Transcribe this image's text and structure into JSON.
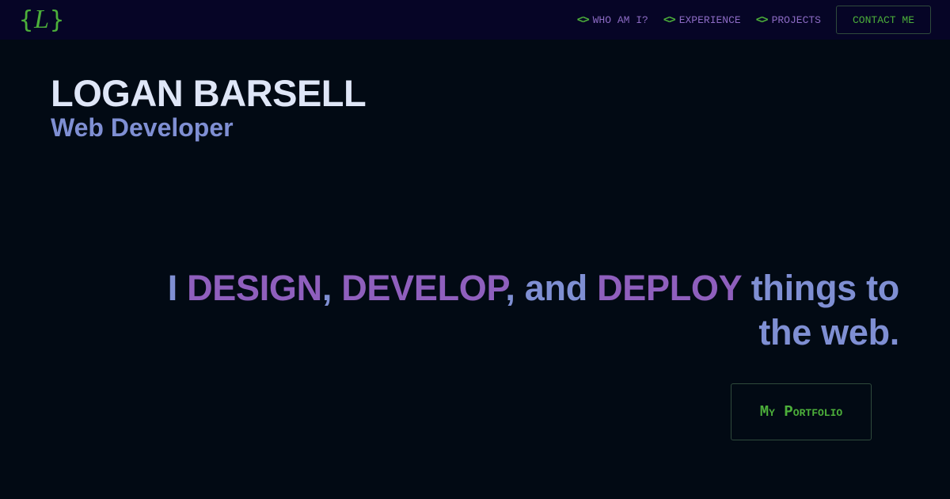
{
  "header": {
    "logo": {
      "open_brace": "{",
      "letter": "L",
      "close_brace": "}"
    },
    "nav": [
      {
        "icon": "<>",
        "label": "WHO AM I?"
      },
      {
        "icon": "<>",
        "label": "EXPERIENCE"
      },
      {
        "icon": "<>",
        "label": "PROJECTS"
      }
    ],
    "contact_label": "CONTACT ME"
  },
  "hero": {
    "name": "LOGAN BARSELL",
    "role": "Web Developer",
    "tagline": {
      "p1": "I ",
      "w1": "DESIGN",
      "p2": ", ",
      "w2": "DEVELOP",
      "p3": ", and ",
      "w3": "DEPLOY",
      "p4": " things to the web."
    },
    "portfolio_label": "My Portfolio"
  },
  "colors": {
    "page_background": "#020a14",
    "nav_background": "#060526",
    "accent_green": "#4caf3a",
    "accent_purple": "#8f5fbd",
    "text_blue": "#7f8fd3",
    "name_white": "#dfe6f7"
  },
  "icons": {
    "nav_icon": "code-brackets-icon"
  }
}
